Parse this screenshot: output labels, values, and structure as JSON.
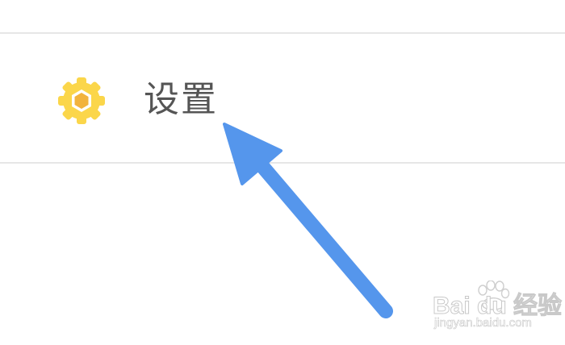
{
  "menu": {
    "settings_item": {
      "label": "设置",
      "icon": "gear-icon"
    }
  },
  "annotation": {
    "arrow_color": "#5596ec"
  },
  "watermark": {
    "brand": "Bai du 经验",
    "url": "jingyan.baidu.com"
  },
  "colors": {
    "icon_outer": "#fbd64a",
    "icon_inner": "#f2b33d",
    "label": "#555555",
    "divider": "#e6e6e6"
  }
}
